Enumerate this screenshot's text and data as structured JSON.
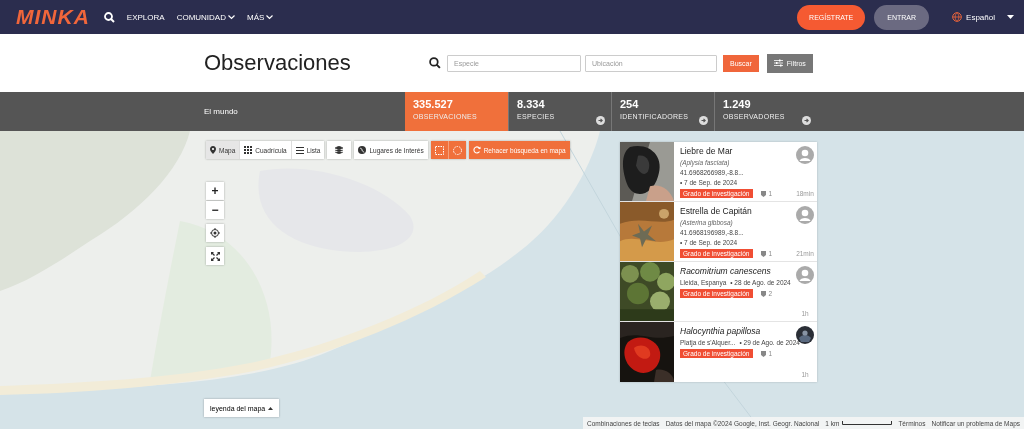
{
  "header": {
    "logo": "MINKA",
    "nav": [
      {
        "label": "EXPLORA",
        "dropdown": false
      },
      {
        "label": "COMUNIDAD",
        "dropdown": true
      },
      {
        "label": "MÁS",
        "dropdown": true
      }
    ],
    "register": "REGÍSTRATE",
    "login": "ENTRAR",
    "language": "Español"
  },
  "page_title": "Observaciones",
  "search": {
    "species_placeholder": "Especie",
    "location_placeholder": "Ubicación",
    "search_button": "Buscar",
    "filters_button": "Filtros"
  },
  "place": "El mundo",
  "stats": [
    {
      "value": "335.527",
      "label": "OBSERVACIONES",
      "selected": true
    },
    {
      "value": "8.334",
      "label": "ESPECIES",
      "selected": false
    },
    {
      "value": "254",
      "label": "IDENTIFICADORES",
      "selected": false
    },
    {
      "value": "1.249",
      "label": "OBSERVADORES",
      "selected": false
    }
  ],
  "map_toolbar": {
    "views": [
      {
        "label": "Mapa",
        "selected": true
      },
      {
        "label": "Cuadrícula",
        "selected": false
      },
      {
        "label": "Lista",
        "selected": false
      }
    ],
    "places_button": "Lugares de Interés",
    "redo_button": "Rehacer búsqueda en mapa"
  },
  "zoom": {
    "in": "+",
    "out": "−"
  },
  "legend_button": "leyenda del mapa",
  "attribution": [
    "Combinaciones de teclas",
    "Datos del mapa ©2024 Google, Inst. Geogr. Nacional",
    "1 km",
    "Términos",
    "Notificar un problema de Maps"
  ],
  "observations": [
    {
      "name": "Liebre de Mar",
      "name_italic": false,
      "scientific": "(Aplysia fasciata)",
      "location": "41.6968266989,-8.8...",
      "date": "• 7 de Sep. de 2024",
      "grade": "Grado de investigación",
      "ids": "1",
      "time": "18min"
    },
    {
      "name": "Estrella de Capitán",
      "name_italic": false,
      "scientific": "(Asterina gibbosa)",
      "location": "41.6968196989,-8.8...",
      "date": "• 7 de Sep. de 2024",
      "grade": "Grado de investigación",
      "ids": "1",
      "time": "21min"
    },
    {
      "name": "Racomitrium canescens",
      "name_italic": true,
      "location": "Lleida, Espanya",
      "date": "• 28 de Ago. de 2024",
      "grade": "Grado de investigación",
      "ids": "2",
      "time": "1h"
    },
    {
      "name": "Halocynthia papillosa",
      "name_italic": true,
      "location": "Platja de s'Alquer...",
      "date": "• 29 de Ago. de 2024",
      "grade": "Grado de investigación",
      "ids": "1",
      "time": "1h"
    }
  ]
}
